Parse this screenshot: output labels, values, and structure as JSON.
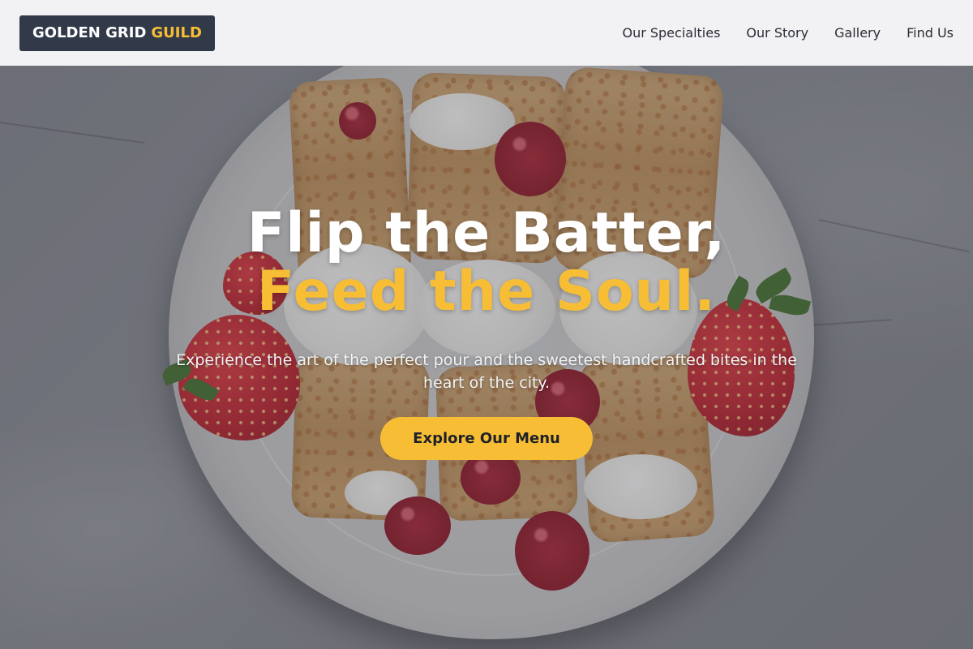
{
  "brand": {
    "name_main": "GOLDEN GRID",
    "name_accent": "GUILD"
  },
  "nav": {
    "items": [
      {
        "label": "Our Specialties"
      },
      {
        "label": "Our Story"
      },
      {
        "label": "Gallery"
      },
      {
        "label": "Find Us"
      }
    ]
  },
  "hero": {
    "headline_line1": "Flip the Batter,",
    "headline_line2": "Feed the Soul.",
    "subtitle": "Experience the art of the perfect pour and the sweetest handcrafted bites in the heart of the city.",
    "cta_label": "Explore Our Menu"
  },
  "colors": {
    "accent": "#f7be35",
    "logo_bg": "#323a4a",
    "nav_bg": "#f2f2f4",
    "nav_text": "#2a2d36"
  }
}
